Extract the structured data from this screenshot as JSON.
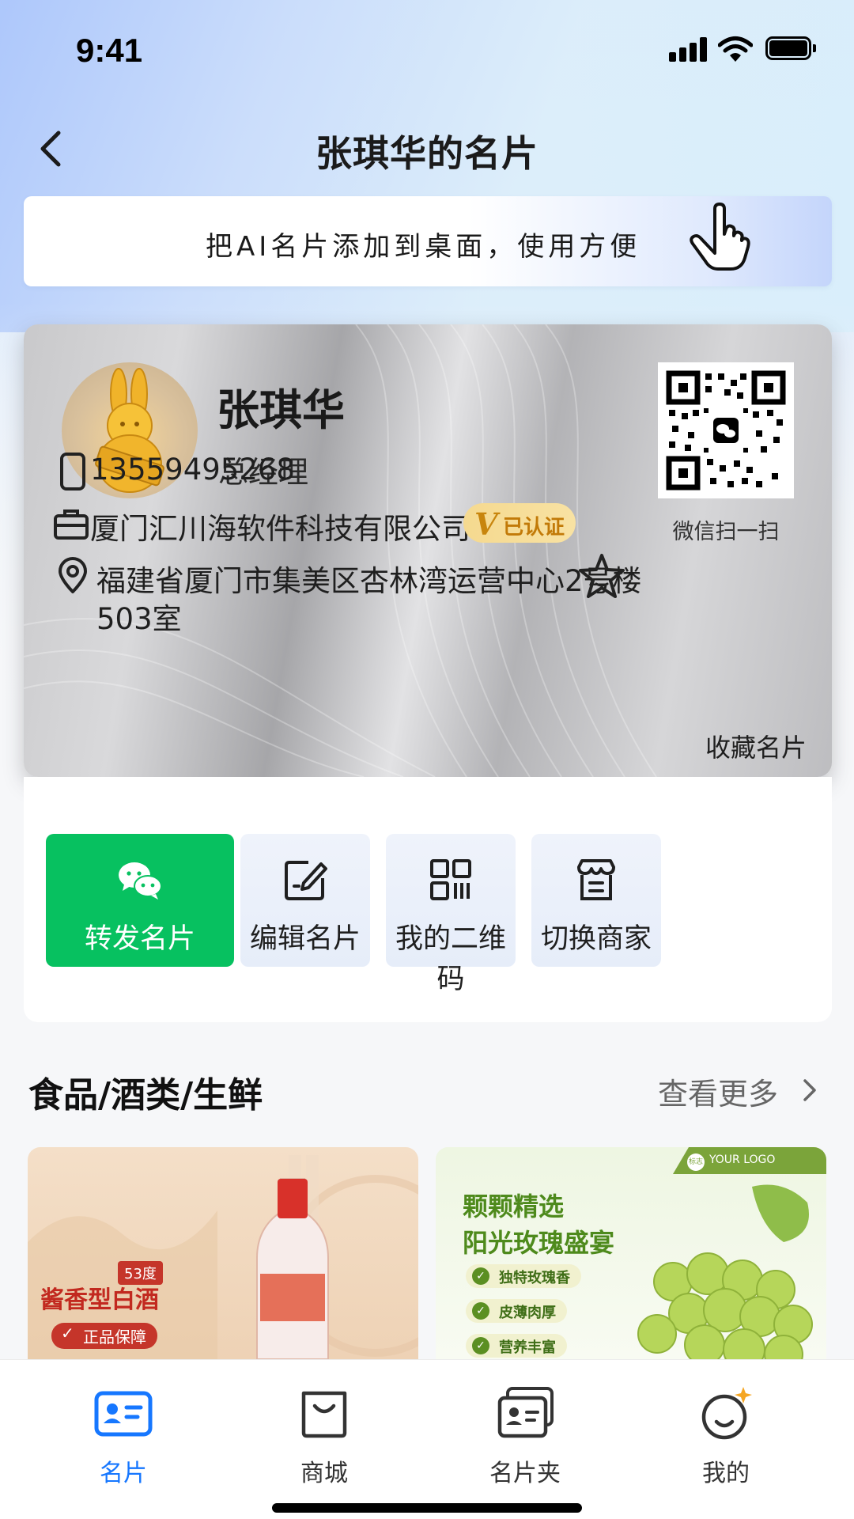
{
  "status_bar": {
    "time": "9:41"
  },
  "nav": {
    "title": "张琪华的名片"
  },
  "banner": {
    "text": "把AI名片添加到桌面，使用方便"
  },
  "card": {
    "name": "张琪华",
    "position": "总经理",
    "qr_label": "微信扫一扫",
    "phone": "13559495268",
    "company": "厦门汇川海软件科技有限公司",
    "verified_badge": {
      "mark": "V",
      "text": "已认证",
      "color": "#c27a08"
    },
    "address_line1": "福建省厦门市集美区杏林湾运营中心2号楼",
    "address_line2": "503室",
    "favorite_label": "收藏名片"
  },
  "actions": [
    {
      "label": "转发名片",
      "icon": "wechat-icon",
      "primary": true
    },
    {
      "label": "编辑名片",
      "icon": "edit-icon"
    },
    {
      "label": "我的二维码",
      "icon": "qrcode-icon"
    },
    {
      "label": "切换商家",
      "icon": "store-icon"
    }
  ],
  "section": {
    "title": "食品/酒类/生鲜",
    "more": "查看更多"
  },
  "products": [
    {
      "tag": "53度",
      "title": "酱香型白酒",
      "pill": "正品保障"
    },
    {
      "logo": "YOUR LOGO",
      "logo_mark": "标志",
      "headline1": "颗颗精选",
      "headline2": "阳光玫瑰盛宴",
      "bullets": [
        "独特玫瑰香",
        "皮薄肉厚",
        "营养丰富"
      ]
    }
  ],
  "tabbar": {
    "items": [
      {
        "label": "名片",
        "icon": "card-icon",
        "active": true
      },
      {
        "label": "商城",
        "icon": "shopping-bag-icon"
      },
      {
        "label": "名片夹",
        "icon": "card-holder-icon"
      },
      {
        "label": "我的",
        "icon": "profile-smile-icon"
      }
    ]
  },
  "colors": {
    "primary_green": "#07c160",
    "active_blue": "#1677ff"
  }
}
